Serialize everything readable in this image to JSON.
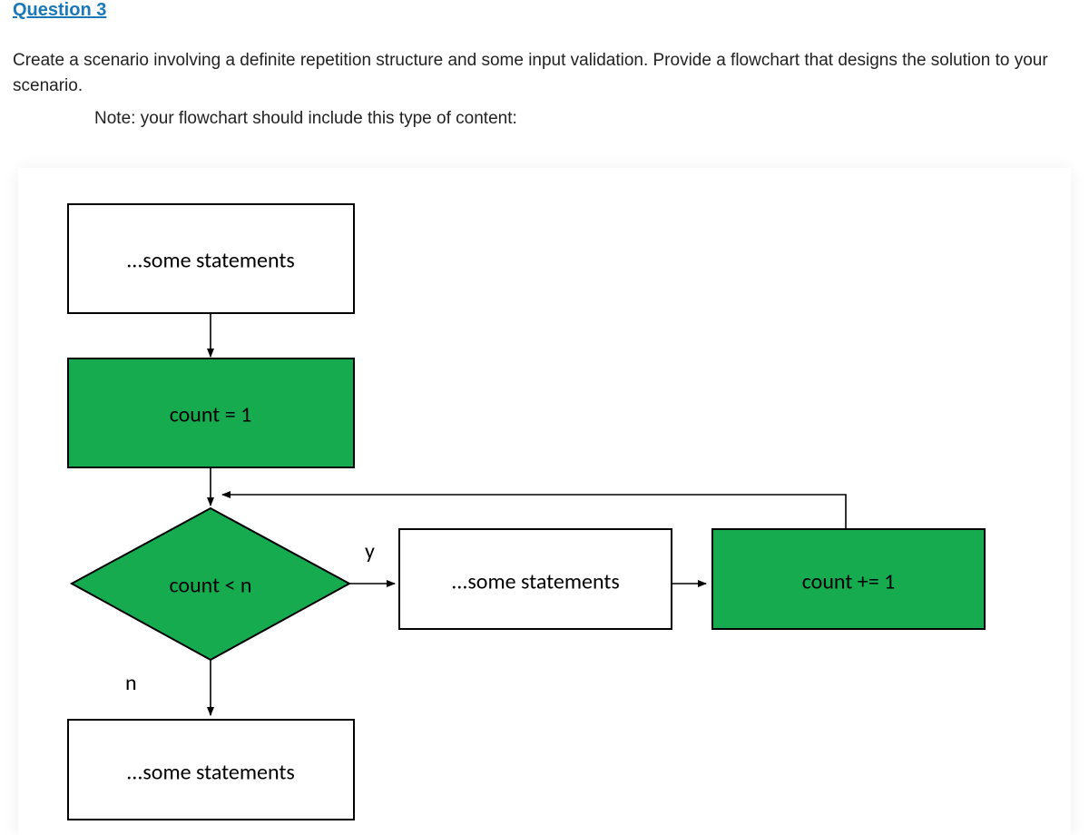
{
  "heading": "Question 3",
  "prompt": "Create a scenario involving a definite repetition structure and some input validation.  Provide a flowchart that designs the solution to your scenario.",
  "note": "Note:  your flowchart should include this type of content:",
  "flow": {
    "top_box": "...some statements",
    "init_box": "count = 1",
    "decision": "count < n",
    "yes_label": "y",
    "no_label": "n",
    "loop_body": "...some statements",
    "increment": "count += 1",
    "after_box": "...some statements"
  }
}
